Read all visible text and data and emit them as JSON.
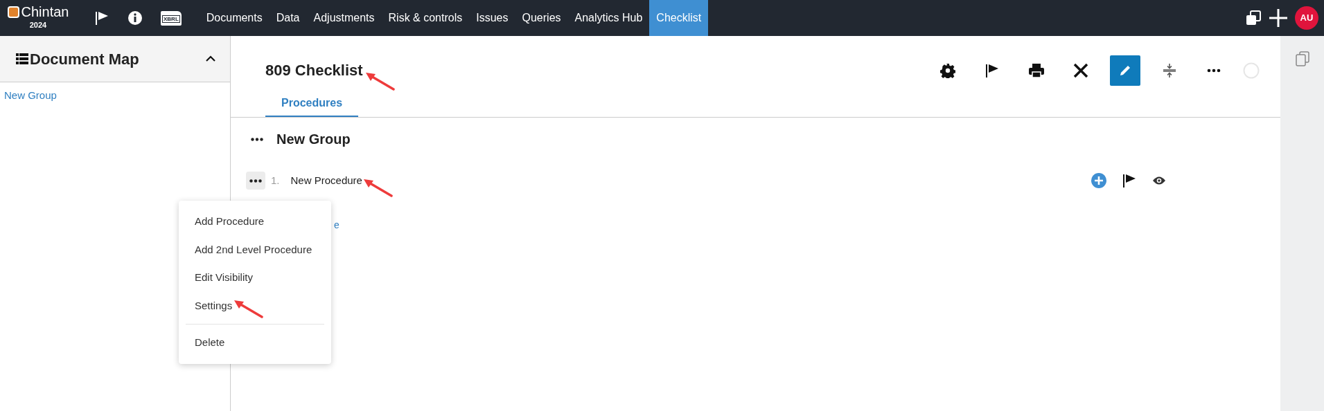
{
  "navbar": {
    "brand": "Chintan",
    "year": "2024",
    "xbrl_label": "XBRL",
    "menu": [
      {
        "label": "Documents",
        "selected": false
      },
      {
        "label": "Data",
        "selected": false
      },
      {
        "label": "Adjustments",
        "selected": false
      },
      {
        "label": "Risk & controls",
        "selected": false
      },
      {
        "label": "Issues",
        "selected": false
      },
      {
        "label": "Queries",
        "selected": false
      },
      {
        "label": "Analytics Hub",
        "selected": false
      },
      {
        "label": "Checklist",
        "selected": true
      }
    ],
    "avatar": "AU"
  },
  "sidebar": {
    "title": "Document Map",
    "expanded": true,
    "items": [
      "New Group"
    ]
  },
  "page": {
    "title": "809 Checklist",
    "title_arrow": true,
    "edit_mode": true,
    "tabs": [
      {
        "label": "Procedures",
        "selected": true
      }
    ],
    "group": {
      "title": "New Group"
    },
    "procedures": [
      {
        "number": "1.",
        "title": "New Procedure",
        "arrow": true,
        "menu_open": true
      }
    ],
    "hidden_link": "e",
    "context_menu": [
      {
        "kind": "item",
        "label": "Add Procedure",
        "arrow": false
      },
      {
        "kind": "item",
        "label": "Add 2nd Level Procedure",
        "arrow": false
      },
      {
        "kind": "item",
        "label": "Edit Visibility",
        "arrow": false
      },
      {
        "kind": "item",
        "label": "Settings",
        "arrow": true
      },
      {
        "kind": "divider"
      },
      {
        "kind": "item",
        "label": "Delete",
        "arrow": false
      }
    ]
  }
}
